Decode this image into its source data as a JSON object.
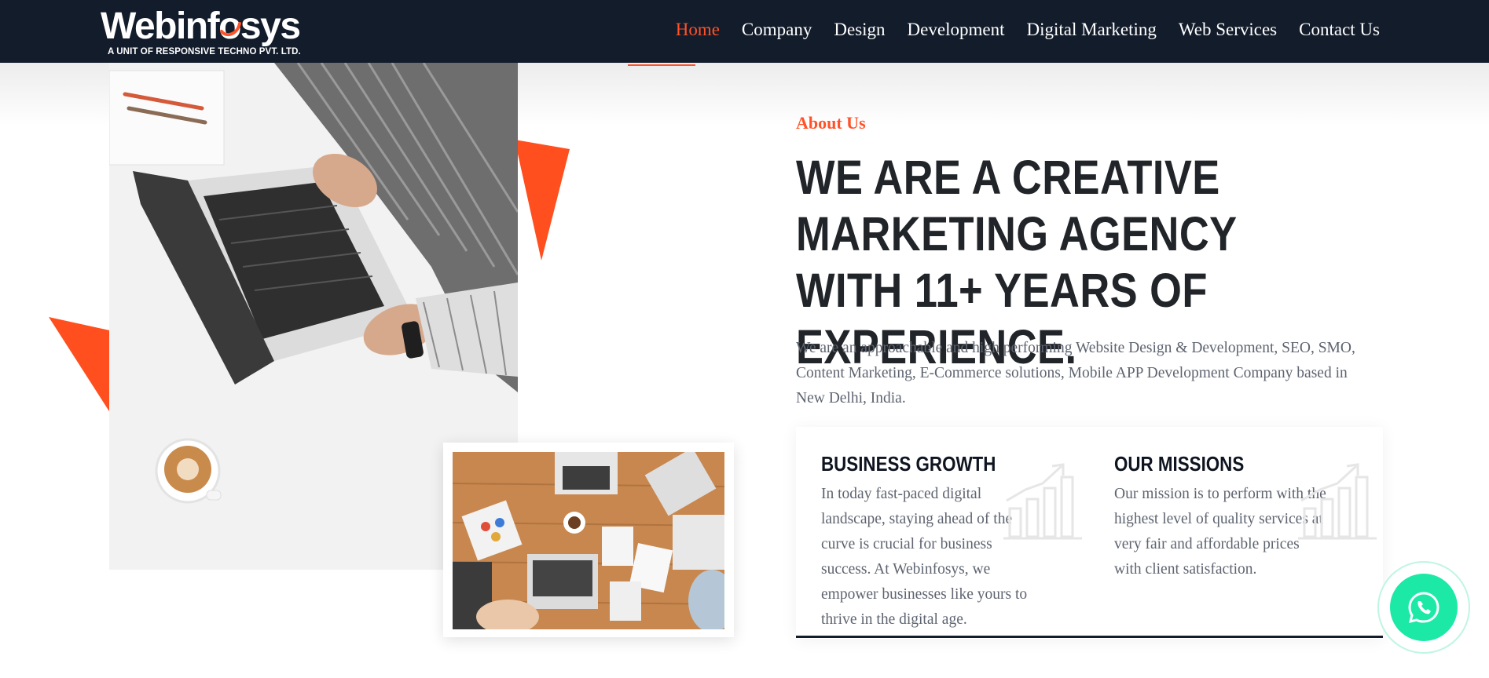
{
  "brand": {
    "logo_prefix": "Webinf",
    "logo_o": "o",
    "logo_suffix": "sys",
    "tagline": "A UNIT OF RESPONSIVE TECHNO PVT. LTD."
  },
  "nav": {
    "items": [
      {
        "label": "Home",
        "active": true
      },
      {
        "label": "Company"
      },
      {
        "label": "Design"
      },
      {
        "label": "Development"
      },
      {
        "label": "Digital Marketing"
      },
      {
        "label": "Web Services"
      },
      {
        "label": "Contact Us"
      }
    ]
  },
  "about": {
    "eyebrow": "About Us",
    "headline": "WE ARE A CREATIVE MARKETING AGENCY WITH 11+ YEARS OF EXPERIENCE.",
    "intro": "We are an approachable and high performing Website Design & Development, SEO, SMO, Content Marketing, E-Commerce solutions, Mobile APP Development Company based in New Delhi, India."
  },
  "cards": [
    {
      "title": "BUSINESS GROWTH",
      "text": "In today fast-paced digital landscape, staying ahead of the curve is crucial for business success. At Webinfosys, we empower businesses like yours to thrive in the digital age.",
      "icon": "growth-chart-icon"
    },
    {
      "title": "OUR MISSIONS",
      "text": "Our mission is to perform with the highest level of quality services at very fair and affordable prices with client satisfaction.",
      "icon": "growth-chart-icon"
    }
  ],
  "colors": {
    "header_bg": "#131c2b",
    "accent": "#ff5228",
    "whatsapp": "#1de9a6",
    "heading": "#212529",
    "body_text": "#5e6470"
  },
  "icons": {
    "whatsapp": "whatsapp-icon"
  }
}
